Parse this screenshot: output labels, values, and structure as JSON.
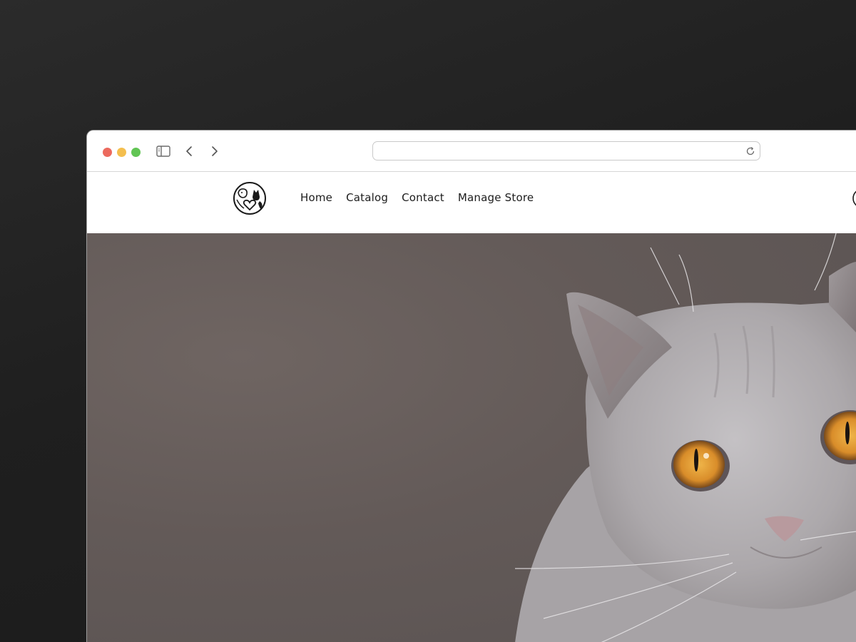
{
  "browser": {
    "url": "",
    "traffic_lights": {
      "close": "#ec6a5e",
      "minimize": "#f4bf4f",
      "zoom": "#61c554"
    }
  },
  "site": {
    "nav": [
      {
        "label": "Home"
      },
      {
        "label": "Catalog"
      },
      {
        "label": "Contact"
      },
      {
        "label": "Manage Store"
      }
    ]
  },
  "hero": {
    "image": "cat-photo"
  }
}
